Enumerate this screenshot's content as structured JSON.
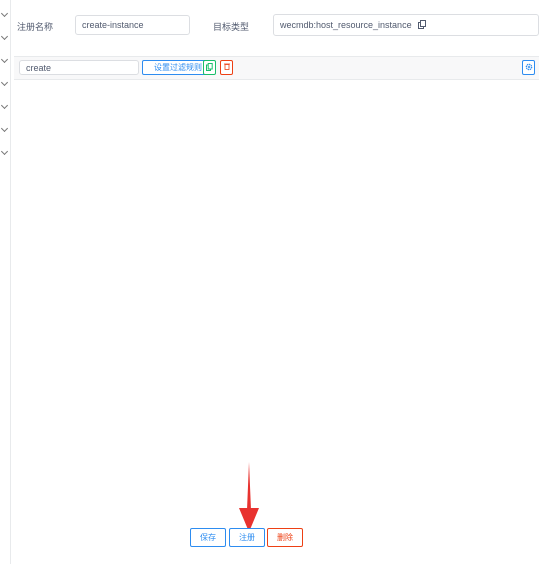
{
  "form": {
    "register_name_label": "注册名称",
    "register_name_value": "create-instance",
    "target_type_label": "目标类型",
    "target_type_value": "wecmdb:host_resource_instance"
  },
  "filter_row": {
    "input_value": "create",
    "set_filter_label": "设置过滤规则"
  },
  "actions": {
    "save_label": "保存",
    "register_label": "注册",
    "delete_label": "删除"
  },
  "icons": {
    "copy": "copy-icon",
    "delete": "trash-icon",
    "settings": "gear-icon",
    "annotation": "arrow-down-icon"
  },
  "colors": {
    "primary": "#2d8cf0",
    "success": "#19be6b",
    "danger": "#ed4014",
    "annotation_arrow": "#e8322f"
  }
}
